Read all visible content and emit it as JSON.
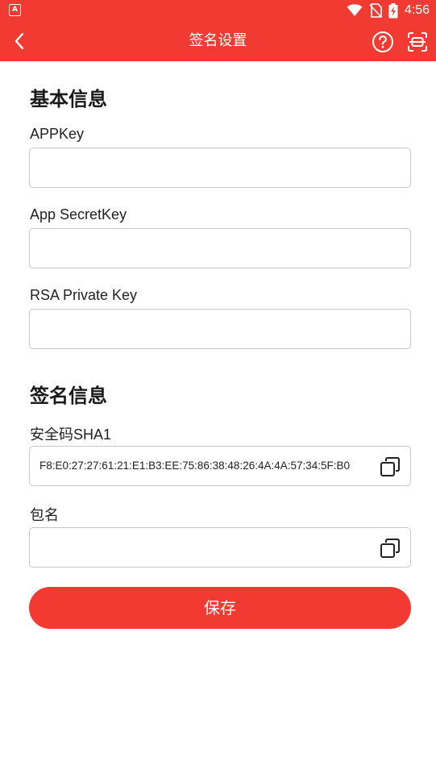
{
  "status_bar": {
    "time": "4:56",
    "icons": [
      "app-notification-icon",
      "wifi-icon",
      "no-sim-icon",
      "battery-charging-icon"
    ]
  },
  "toolbar": {
    "title": "签名设置",
    "icons": [
      "back-arrow-icon",
      "help-icon",
      "scan-icon"
    ]
  },
  "basic_info": {
    "title": "基本信息",
    "app_key": {
      "label": "APPKey",
      "value": ""
    },
    "app_secret_key": {
      "label": "App SecretKey",
      "value": ""
    },
    "rsa_private_key": {
      "label": "RSA Private Key",
      "value": ""
    }
  },
  "signature_info": {
    "title": "签名信息",
    "sha1": {
      "label": "安全码SHA1",
      "value": "F8:E0:27:27:61:21:E1:B3:EE:75:86:38:48:26:4A:4A:57:34:5F:B0"
    },
    "package_name": {
      "label": "包名",
      "value": ""
    }
  },
  "save_button": {
    "label": "保存"
  },
  "colors": {
    "brand": "#f13b32",
    "border": "#c9c9c9"
  }
}
